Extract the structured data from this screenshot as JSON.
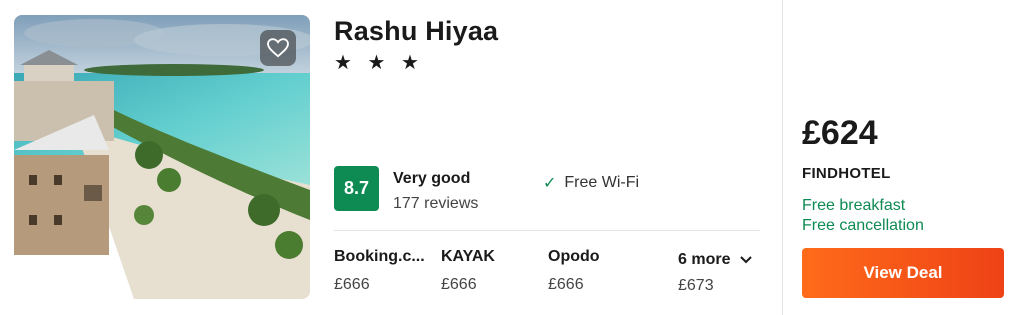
{
  "hotel": {
    "name": "Rashu Hiyaa",
    "stars": "★ ★ ★",
    "image_alt": "Hotel photo",
    "favorite_icon": "heart-outline-icon"
  },
  "rating": {
    "score": "8.7",
    "label": "Very good",
    "reviews": "177 reviews",
    "color": "#0e8a53"
  },
  "amenities": [
    {
      "label": "Free Wi-Fi",
      "icon": "check-icon"
    }
  ],
  "providers": [
    {
      "name": "Booking.c...",
      "price": "£666"
    },
    {
      "name": "KAYAK",
      "price": "£666"
    },
    {
      "name": "Opodo",
      "price": "£666"
    }
  ],
  "more_providers": {
    "label": "6 more",
    "price": "£673",
    "icon": "chevron-down-icon"
  },
  "deal": {
    "price": "£624",
    "vendor": "FINDHOTEL",
    "perks": [
      "Free breakfast",
      "Free cancellation"
    ],
    "button_label": "View Deal",
    "accent": "#ff6b1a",
    "perk_color": "#0e8a53"
  }
}
